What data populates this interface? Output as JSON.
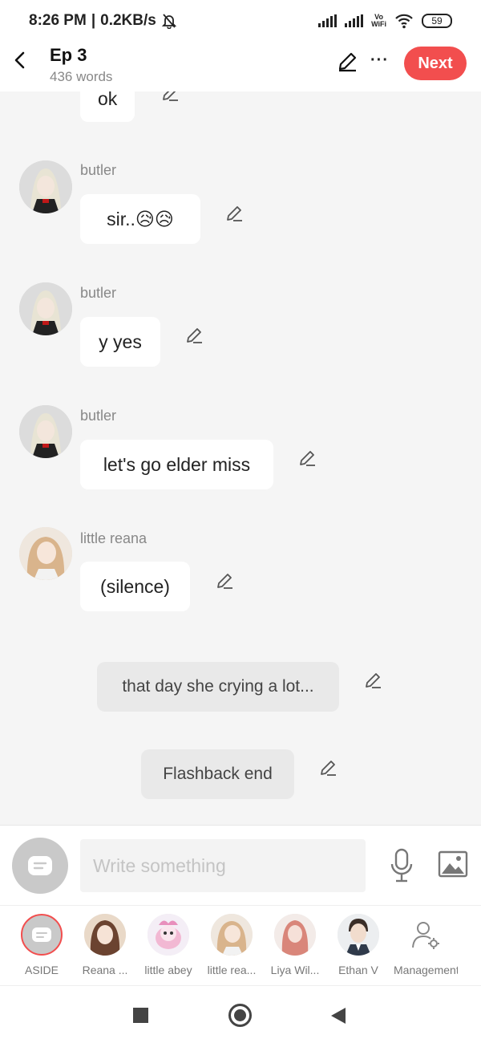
{
  "status_bar": {
    "time": "8:26 PM",
    "net_speed": "0.2KB/s",
    "vowifi_line1": "Vo",
    "vowifi_line2": "WiFi",
    "battery": "59"
  },
  "header": {
    "title": "Ep 3",
    "word_count": "436 words",
    "next_label": "Next",
    "accent_color": "#f24e4e"
  },
  "messages": [
    {
      "speaker": "",
      "text": "ok"
    },
    {
      "speaker": "butler",
      "text": "sir..😥😥"
    },
    {
      "speaker": "butler",
      "text": "y yes"
    },
    {
      "speaker": "butler",
      "text": "let's go elder miss"
    },
    {
      "speaker": "little reana",
      "text": "(silence)"
    },
    {
      "speaker": "",
      "text": "that day she crying a lot..."
    },
    {
      "speaker": "",
      "text": "Flashback end"
    }
  ],
  "composer": {
    "placeholder": "Write something",
    "mic_icon": "microphone-icon",
    "image_icon": "image-icon"
  },
  "characters": [
    {
      "label": "ASIDE"
    },
    {
      "label": "Reana ..."
    },
    {
      "label": "little abey"
    },
    {
      "label": "little rea..."
    },
    {
      "label": "Liya Wil..."
    },
    {
      "label": "Ethan V"
    },
    {
      "label": "Management"
    }
  ]
}
